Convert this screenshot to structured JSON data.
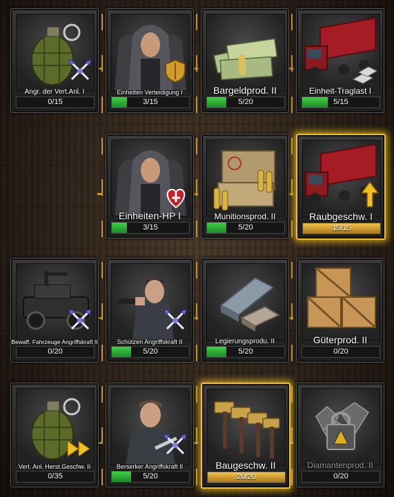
{
  "colors": {
    "accent_gold": "#f2c01e",
    "progress_green": "#2fbf3a",
    "progress_gold": "#d7a233"
  },
  "rows": [
    [
      {
        "label": "Angr. der Vert.Anl. I",
        "progress": "0/15",
        "value": 0,
        "max": 15,
        "art": "grenade",
        "badge": "crossed-swords-icon",
        "dim": false
      },
      {
        "label": "Einheiten Verteidigung I",
        "progress": "3/15",
        "value": 3,
        "max": 15,
        "art": "hooded-men",
        "badge": "shield-icon",
        "dim": false
      },
      {
        "label": "Bargeldprod. II",
        "progress": "5/20",
        "value": 5,
        "max": 20,
        "art": "cash-stacks",
        "badge": "",
        "dim": false
      },
      {
        "label": "Einheit-Traglast I",
        "progress": "5/15",
        "value": 5,
        "max": 15,
        "art": "red-truck",
        "badge": "silver-bars-icon",
        "dim": false
      }
    ],
    [
      null,
      {
        "label": "Einheiten-HP I",
        "progress": "3/15",
        "value": 3,
        "max": 15,
        "art": "hooded-men",
        "badge": "heart-plus-icon",
        "dim": false
      },
      {
        "label": "Munitionsprod. II",
        "progress": "5/20",
        "value": 5,
        "max": 20,
        "art": "ammo-crate",
        "badge": "",
        "dim": false
      },
      {
        "label": "Raubgeschw. I",
        "progress": "15/15",
        "value": 15,
        "max": 15,
        "art": "red-truck",
        "badge": "up-arrow-icon",
        "dim": false,
        "gold": true
      }
    ],
    [
      {
        "label": "Bewaff. Fahrzeuge Angriffskraft II",
        "progress": "0/20",
        "value": 0,
        "max": 20,
        "art": "armed-jeep",
        "badge": "crossed-swords-icon",
        "dim": false
      },
      {
        "label": "Schützen Angriffskraft II",
        "progress": "5/20",
        "value": 5,
        "max": 20,
        "art": "gunman",
        "badge": "crossed-swords-icon",
        "dim": false
      },
      {
        "label": "Legierungsprodu. II",
        "progress": "5/20",
        "value": 5,
        "max": 20,
        "art": "metal-ingots",
        "badge": "",
        "dim": false
      },
      {
        "label": "Güterprod. II",
        "progress": "0/20",
        "value": 0,
        "max": 20,
        "art": "wooden-crates",
        "badge": "",
        "dim": false
      }
    ],
    [
      {
        "label": "Vert. Anl. Herst.Geschw. II",
        "progress": "0/35",
        "value": 0,
        "max": 35,
        "art": "grenade",
        "badge": "fast-forward-icon",
        "dim": false
      },
      {
        "label": "Berserker Angriffskraft II",
        "progress": "5/20",
        "value": 5,
        "max": 20,
        "art": "knife-man",
        "badge": "crossed-swords-icon",
        "dim": false
      },
      {
        "label": "Baugeschw. II",
        "progress": "20/20",
        "value": 20,
        "max": 20,
        "art": "hammers",
        "badge": "",
        "dim": false,
        "gold": true
      },
      {
        "label": "Diamantenprod. II",
        "progress": "0/20",
        "value": 0,
        "max": 20,
        "art": "locked-diamonds",
        "badge": "padlock-icon",
        "dim": true
      }
    ]
  ]
}
